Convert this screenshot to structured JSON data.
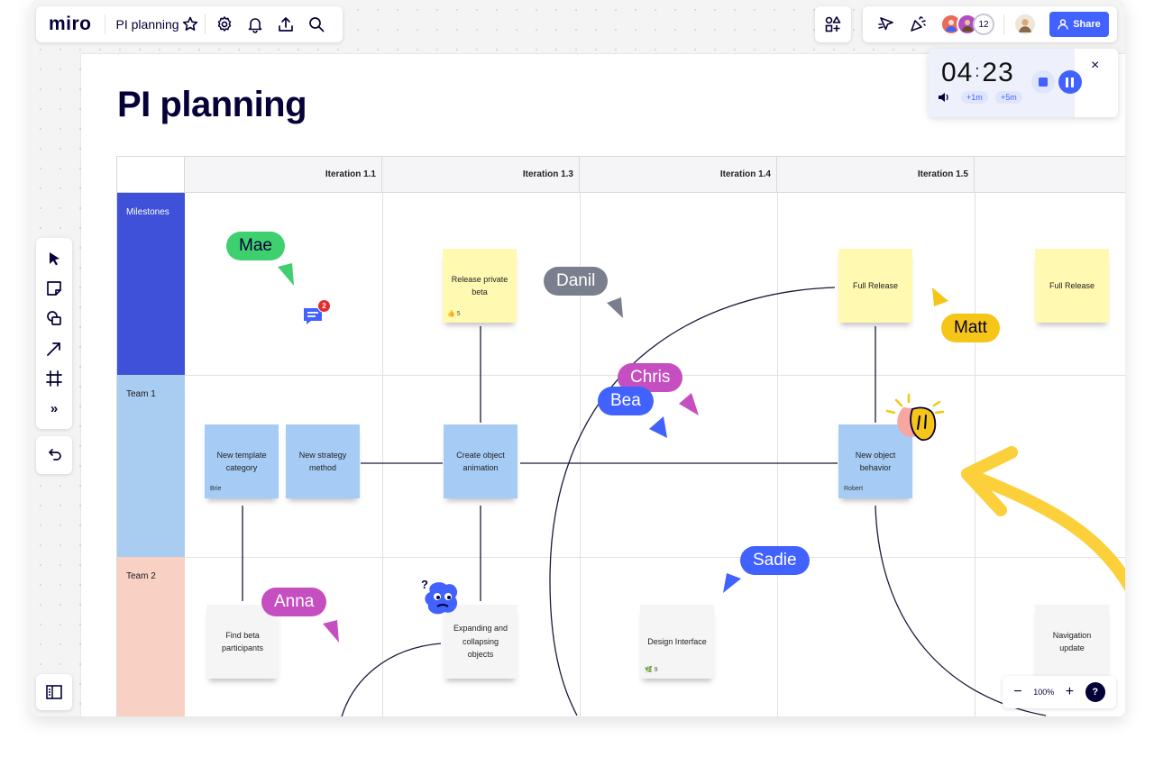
{
  "app": {
    "logo": "miro",
    "board_name": "PI planning",
    "icons": [
      "star-icon",
      "gear-icon",
      "bell-icon",
      "upload-icon",
      "search-icon"
    ]
  },
  "toolbar_right": {
    "participants_count": "12",
    "share_label": "Share",
    "accent": "#4262ff"
  },
  "timer": {
    "minutes": "04",
    "seconds": "23",
    "add_1": "+1m",
    "add_5": "+5m",
    "close": "×"
  },
  "left_toolbar": {
    "more": "»"
  },
  "frame": {
    "title": "PI planning"
  },
  "grid": {
    "columns": [
      "Iteration 1.1",
      "Iteration 1.3",
      "Iteration 1.4",
      "Iteration 1.5"
    ],
    "rows": [
      {
        "label": "Milestones",
        "color": "#3f51d8"
      },
      {
        "label": "Team 1",
        "color": "#a9ccf1"
      },
      {
        "label": "Team 2",
        "color": "#f9d1c4"
      }
    ]
  },
  "stickies": {
    "release_beta": {
      "text": "Release private beta",
      "reactions": "5"
    },
    "full_release_1": {
      "text": "Full Release"
    },
    "full_release_2": {
      "text": "Full Release"
    },
    "template": {
      "text": "New template category",
      "author": "Brie"
    },
    "strategy": {
      "text": "New strategy method"
    },
    "animation": {
      "text": "Create object animation"
    },
    "behavior": {
      "text": "New object behavior",
      "author": "Robert"
    },
    "beta_participants": {
      "text": "Find beta participants"
    },
    "expanding": {
      "text": "Expanding and collapsing objects"
    },
    "design": {
      "text": "Design Interface",
      "reactions": "9"
    },
    "navigation": {
      "text": "Navigation update"
    }
  },
  "comment_badge": "2",
  "cursors": [
    {
      "name": "Mae",
      "color": "#3ecf6e"
    },
    {
      "name": "Danil",
      "color": "#7a7f8e"
    },
    {
      "name": "Chris",
      "color": "#c54fc1"
    },
    {
      "name": "Bea",
      "color": "#4262ff"
    },
    {
      "name": "Matt",
      "color": "#f5c518"
    },
    {
      "name": "Sadie",
      "color": "#4262ff"
    },
    {
      "name": "Anna",
      "color": "#c54fc1"
    }
  ],
  "zoom": {
    "minus": "−",
    "level": "100%",
    "plus": "+",
    "help": "?"
  }
}
